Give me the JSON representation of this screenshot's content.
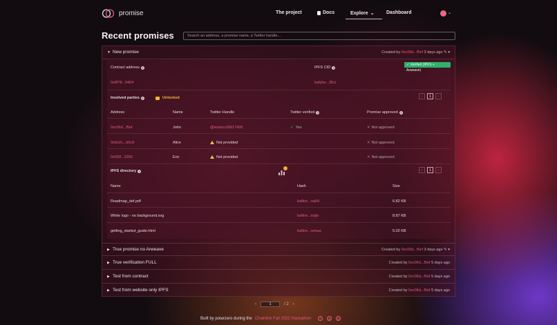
{
  "header": {
    "brand": "promise",
    "nav": {
      "project": "The project",
      "docs": "Docs",
      "explore": "Explore",
      "dashboard": "Dashboard"
    }
  },
  "page": {
    "title": "Recent promises",
    "search_placeholder": "Search an address, a promise name, a Twitter handle..."
  },
  "open_promise": {
    "name": "New promise",
    "created_prefix": "Created by",
    "created_addr": "0xc06d...f5ef",
    "created_ago": "3 days ago",
    "contract_label": "Contract address",
    "contract_value": "0x8f78...9404",
    "ipfs_label": "IPFS CID",
    "ipfs_value": "bafybe...35ci",
    "verified_badge": "Verified (IPFS + Arweave)",
    "parties_label": "Involved parties",
    "unlocked_label": "Unlocked",
    "parties_page": "1",
    "parties_columns": [
      "Address",
      "Name",
      "Twitter Handle",
      "Twitter verified",
      "Promise approved"
    ],
    "parties": [
      {
        "address": "0xc06d...f5ef",
        "name": "John",
        "handle": "@testacc09617400",
        "verified": "Yes",
        "approved": "Not approved"
      },
      {
        "address": "0x6e2c...b0c9",
        "name": "Alice",
        "handle": "Not provided",
        "verified": "",
        "approved": "Not approved"
      },
      {
        "address": "0xf39f...2266",
        "name": "Eric",
        "handle": "Not provided",
        "verified": "",
        "approved": "Not approved"
      }
    ],
    "ipfs_dir_label": "IPFS directory",
    "ipfs_dir_page": "1",
    "files_columns": [
      "Name",
      "Hash",
      "Size"
    ],
    "files": [
      {
        "name": "Roadmap_def.pdf",
        "hash": "bafkre...oq54",
        "size": "6.82 KB"
      },
      {
        "name": "White logo - no background.svg",
        "hash": "bafkre...ioqlo",
        "size": "8.87 KB"
      },
      {
        "name": "getting_started_guide.html",
        "hash": "bafkre...wmaa",
        "size": "5.02 KB"
      }
    ]
  },
  "collapsed": [
    {
      "name": "True promise no Arweave",
      "addr": "0xc06d...f5ef",
      "ago": "3 days ago",
      "edit": true
    },
    {
      "name": "True verification FULL",
      "addr": "0xc06d...f5ef",
      "ago": "5 days ago"
    },
    {
      "name": "Test from contract",
      "addr": "0xc06d...f5ef",
      "ago": "5 days ago"
    },
    {
      "name": "Test from website only IPFS",
      "addr": "0xc06d...f5ef",
      "ago": "5 days ago"
    }
  ],
  "pagination": {
    "current": "1",
    "total": "/ 2"
  },
  "footer": {
    "text": "Built by polarzero during the",
    "hackathon": "Chainlink Fall 2022 Hackathon"
  },
  "colors": {
    "accent": "#e25b7a",
    "verified": "#2fb06d",
    "warning": "#e6c34a"
  }
}
